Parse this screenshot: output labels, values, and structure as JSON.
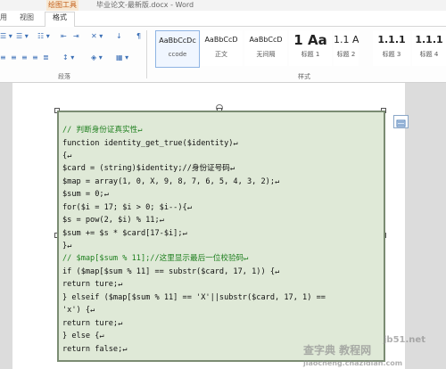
{
  "window": {
    "title": "毕业论文-最新版.docx - Word",
    "contextual_tab": "绘图工具"
  },
  "tabs": {
    "left": "用",
    "view": "视图",
    "format": "格式"
  },
  "ribbon": {
    "paragraph_label": "段落",
    "styles_label": "样式",
    "styles": [
      {
        "sample": "AaBbCcDc",
        "name": "ccode"
      },
      {
        "sample": "AaBbCcD",
        "name": "正文"
      },
      {
        "sample": "AaBbCcD",
        "name": "无间隔"
      },
      {
        "sample": "1  Aa",
        "name": "标题 1"
      },
      {
        "sample": "1.1  A",
        "name": "标题 2"
      },
      {
        "sample": "1.1.1",
        "name": "标题 3"
      },
      {
        "sample": "1.1.1",
        "name": "标题 4"
      }
    ]
  },
  "code_lines": [
    "// 判断身份证真实性↵",
    "function identity_get_true($identity)↵",
    "{↵",
    "  $card = (string)$identity;//身份证号码↵",
    "  $map = array(1, 0, X, 9, 8, 7, 6, 5, 4, 3, 2);↵",
    "  $sum = 0;↵",
    "  for($i = 17; $i > 0; $i--){↵",
    "  $s = pow(2, $i) % 11;↵",
    "  $sum += $s * $card[17-$i];↵",
    "  }↵",
    "  // $map[$sum % 11];//这里显示最后一位校验码↵",
    "  if ($map[$sum % 11] == substr($card, 17, 1)) {↵",
    "    return ture;↵",
    "  } elseif ($map[$sum % 11] == 'X'||substr($card, 17, 1) ==",
    "  'x') {↵",
    "    return ture;↵",
    "  } else {↵",
    "    return false;↵"
  ],
  "watermark": {
    "line1": "查字典 教程网",
    "line2": "jiaocheng.chazidian.com",
    "site": "jb51.net"
  },
  "colors": {
    "code_bg": "#dfe9d7",
    "comment": "#1e7f1e",
    "keyword": "#2d2dbf",
    "frame": "#7b8c73"
  }
}
